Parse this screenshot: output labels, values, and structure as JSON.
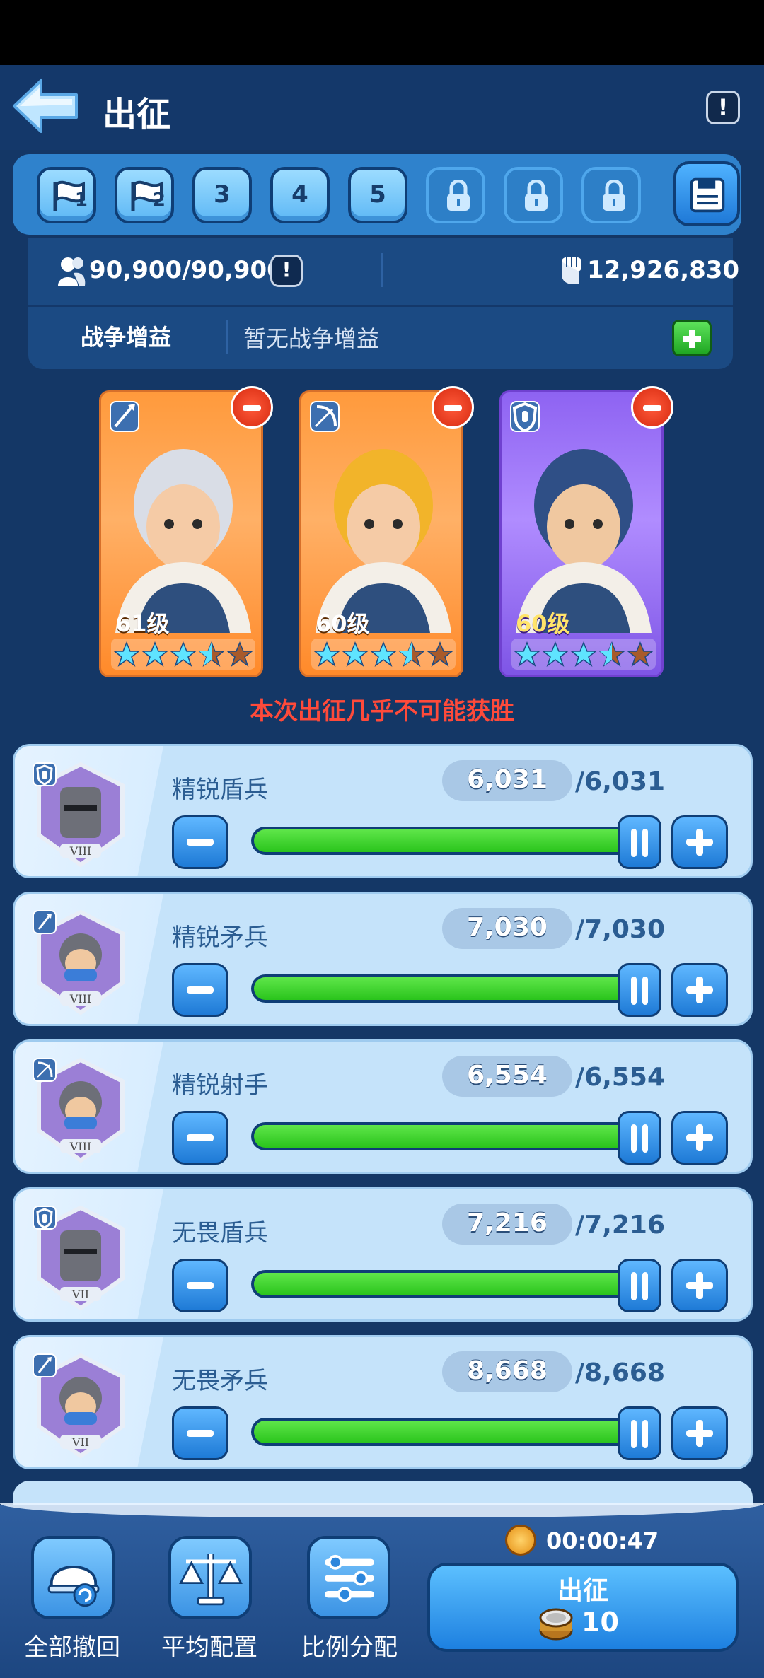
{
  "header": {
    "title": "出征",
    "info_label": "!"
  },
  "presets": [
    {
      "type": "flag",
      "label": "1",
      "icon": "flag-icon"
    },
    {
      "type": "flag",
      "label": "2",
      "icon": "flag-icon"
    },
    {
      "type": "number",
      "label": "3"
    },
    {
      "type": "number",
      "label": "4"
    },
    {
      "type": "number",
      "label": "5"
    },
    {
      "type": "locked",
      "icon": "lock-icon"
    },
    {
      "type": "locked",
      "icon": "lock-icon"
    },
    {
      "type": "locked",
      "icon": "lock-icon"
    }
  ],
  "stats": {
    "troops": "90,900/90,900",
    "troops_info": "!",
    "power": "12,926,830",
    "war_buff_label": "战争增益",
    "war_buff_value": "暂无战争增益"
  },
  "heroes": [
    {
      "level": "61级",
      "class_icon": "spear-icon",
      "stars": 3.5,
      "card_color": "orange"
    },
    {
      "level": "60级",
      "class_icon": "bow-icon",
      "stars": 3.5,
      "card_color": "orange"
    },
    {
      "level": "60级",
      "class_icon": "shield-icon",
      "stars": 3.5,
      "card_color": "purple"
    }
  ],
  "warning": "本次出征几乎不可能获胜",
  "troops": [
    {
      "name": "精锐盾兵",
      "count": "6,031",
      "max": "/6,031",
      "tier": "VIII",
      "class_icon": "shield-icon",
      "fill": 1.0
    },
    {
      "name": "精锐矛兵",
      "count": "7,030",
      "max": "/7,030",
      "tier": "VIII",
      "class_icon": "spear-icon",
      "fill": 1.0
    },
    {
      "name": "精锐射手",
      "count": "6,554",
      "max": "/6,554",
      "tier": "VIII",
      "class_icon": "bow-icon",
      "fill": 1.0
    },
    {
      "name": "无畏盾兵",
      "count": "7,216",
      "max": "/7,216",
      "tier": "VII",
      "class_icon": "shield-icon",
      "fill": 1.0
    },
    {
      "name": "无畏矛兵",
      "count": "8,668",
      "max": "/8,668",
      "tier": "VII",
      "class_icon": "spear-icon",
      "fill": 1.0
    }
  ],
  "bottom": {
    "recall_all": "全部撤回",
    "even_config": "平均配置",
    "ratio_alloc": "比例分配",
    "timer": "00:00:47",
    "march_label": "出征",
    "march_cost": "10"
  },
  "colors": {
    "background": "#143766",
    "warning": "#ff4a3a",
    "fill": "#2ac41c",
    "accent": "#1e7ad6"
  }
}
